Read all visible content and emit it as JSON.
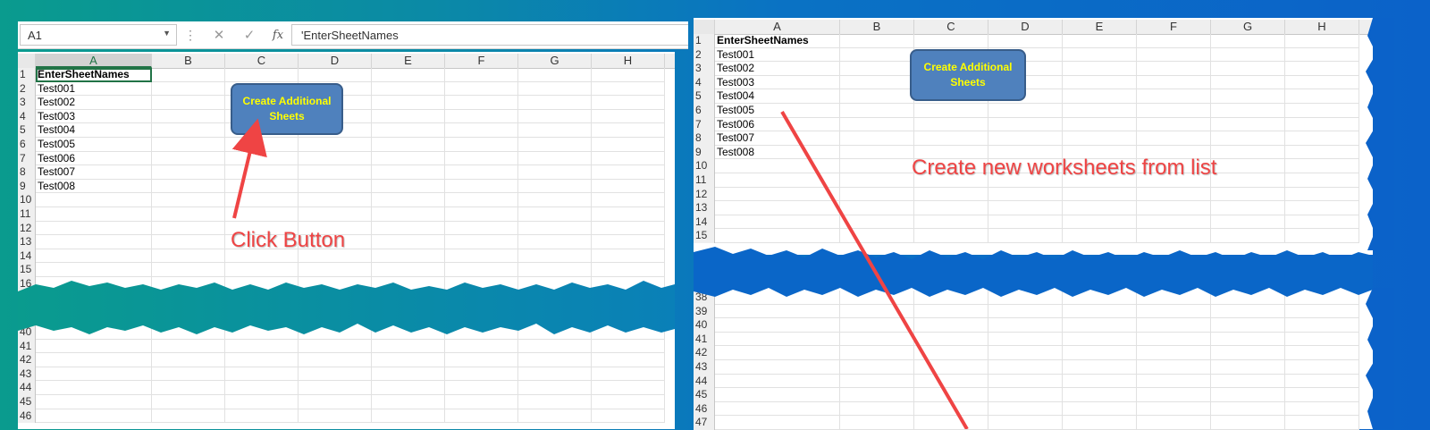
{
  "left_panel": {
    "name_box": "A1",
    "formula_content": "'EnterSheetNames",
    "columns": [
      "A",
      "B",
      "C",
      "D",
      "E",
      "F",
      "G",
      "H"
    ],
    "rows_top": [
      {
        "num": "1",
        "a": "EnterSheetNames"
      },
      {
        "num": "2",
        "a": "Test001"
      },
      {
        "num": "3",
        "a": "Test002"
      },
      {
        "num": "4",
        "a": "Test003"
      },
      {
        "num": "5",
        "a": "Test004"
      },
      {
        "num": "6",
        "a": "Test005"
      },
      {
        "num": "7",
        "a": "Test006"
      },
      {
        "num": "8",
        "a": "Test007"
      },
      {
        "num": "9",
        "a": "Test008"
      },
      {
        "num": "10",
        "a": ""
      },
      {
        "num": "11",
        "a": ""
      },
      {
        "num": "12",
        "a": ""
      },
      {
        "num": "13",
        "a": ""
      },
      {
        "num": "14",
        "a": ""
      },
      {
        "num": "15",
        "a": ""
      },
      {
        "num": "16",
        "a": ""
      }
    ],
    "rows_bottom": [
      "40",
      "41",
      "42",
      "43",
      "44",
      "45",
      "46"
    ],
    "button_label": "Create Additional Sheets",
    "annotation": "Click Button"
  },
  "right_panel": {
    "columns": [
      "A",
      "B",
      "C",
      "D",
      "E",
      "F",
      "G",
      "H"
    ],
    "rows_top": [
      {
        "num": "1",
        "a": "EnterSheetNames"
      },
      {
        "num": "2",
        "a": "Test001"
      },
      {
        "num": "3",
        "a": "Test002"
      },
      {
        "num": "4",
        "a": "Test003"
      },
      {
        "num": "5",
        "a": "Test004"
      },
      {
        "num": "6",
        "a": "Test005"
      },
      {
        "num": "7",
        "a": "Test006"
      },
      {
        "num": "8",
        "a": "Test007"
      },
      {
        "num": "9",
        "a": "Test008"
      },
      {
        "num": "10",
        "a": ""
      },
      {
        "num": "11",
        "a": ""
      },
      {
        "num": "12",
        "a": ""
      },
      {
        "num": "13",
        "a": ""
      },
      {
        "num": "14",
        "a": ""
      },
      {
        "num": "15",
        "a": ""
      }
    ],
    "rows_bottom": [
      "38",
      "39",
      "40",
      "41",
      "42",
      "43",
      "44",
      "45",
      "46",
      "47"
    ],
    "button_label": "Create Additional Sheets",
    "annotation": "Create new worksheets from list"
  },
  "icons": {
    "cancel": "close-icon",
    "enter": "check-icon",
    "function": "fx-icon"
  },
  "colors": {
    "button_fill": "#4f81bd",
    "button_text": "#ffff00",
    "annotation": "#ef4444",
    "selection": "#217346"
  }
}
